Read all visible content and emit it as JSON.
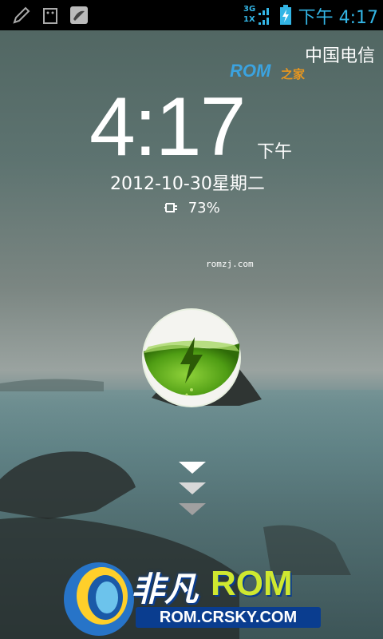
{
  "status_bar": {
    "time": "下午 4:17",
    "network_top": "3G",
    "network_bottom": "1X",
    "icons": [
      "edit-icon",
      "sim-tool-icon",
      "notes-app-icon",
      "battery-charging-icon"
    ]
  },
  "lockscreen": {
    "carrier": "中国电信",
    "brand_logo": "ROM之家",
    "time": "4:17",
    "ampm": "下午",
    "date": "2012-10-30星期二",
    "battery_percent": "73%",
    "watermark": "romzj.com",
    "charge_orb_icon": "lightning-icon",
    "unlock_hint_icon": "chevron-down-icon"
  },
  "overlay_logo": {
    "name": "非凡",
    "rom": "ROM",
    "url": "ROM.CRSKY.COM"
  },
  "colors": {
    "accent": "#33b5e5",
    "orb_green": "#5fb51a"
  }
}
